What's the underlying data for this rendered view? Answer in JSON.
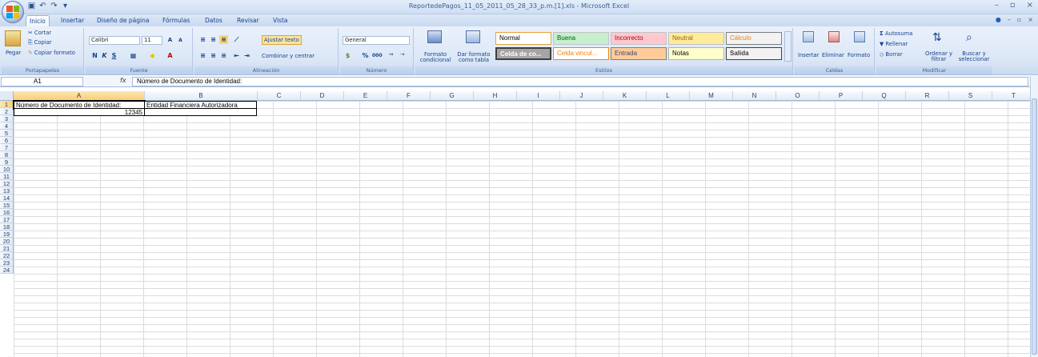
{
  "window": {
    "title": "ReportedePagos_11_05_2011_05_28_33_p.m.[1].xls - Microsoft Excel",
    "minimize": "–",
    "restore": "▫",
    "close": "×"
  },
  "tabs": [
    "Inicio",
    "Insertar",
    "Diseño de página",
    "Fórmulas",
    "Datos",
    "Revisar",
    "Vista"
  ],
  "ribbon": {
    "clipboard": {
      "label": "Portapapeles",
      "paste": "Pegar",
      "cut": "Cortar",
      "copy": "Copiar",
      "format_painter": "Copiar formato"
    },
    "font": {
      "label": "Fuente",
      "name": "Calibri",
      "size": "11",
      "bold": "N",
      "italic": "K",
      "underline": "S"
    },
    "alignment": {
      "label": "Alineación",
      "wrap": "Ajustar texto",
      "merge": "Combinar y centrar"
    },
    "number": {
      "label": "Número",
      "format": "General",
      "percent": "%",
      "thousands": "000"
    },
    "styles": {
      "label": "Estilos",
      "conditional": "Formato condicional",
      "as_table": "Dar formato como tabla",
      "cells": [
        {
          "name": "Normal",
          "bg": "#ffffff",
          "fg": "#000000"
        },
        {
          "name": "Buena",
          "bg": "#c6efce",
          "fg": "#006100"
        },
        {
          "name": "Incorrecto",
          "bg": "#ffc7ce",
          "fg": "#9c0006"
        },
        {
          "name": "Neutral",
          "bg": "#ffeb9c",
          "fg": "#9c6500"
        },
        {
          "name": "Cálculo",
          "bg": "#f2f2f2",
          "fg": "#fa7d00"
        },
        {
          "name": "Celda de co...",
          "bg": "#a5a5a5",
          "fg": "#ffffff"
        },
        {
          "name": "Celda vincul...",
          "bg": "#ffffff",
          "fg": "#fa7d00"
        },
        {
          "name": "Entrada",
          "bg": "#ffcc99",
          "fg": "#3f3f76"
        },
        {
          "name": "Notas",
          "bg": "#ffffcc",
          "fg": "#000000"
        },
        {
          "name": "Salida",
          "bg": "#f2f2f2",
          "fg": "#3f3f3f"
        }
      ]
    },
    "cells": {
      "label": "Celdas",
      "insert": "Insertar",
      "delete": "Eliminar",
      "format": "Formato"
    },
    "editing": {
      "label": "Modificar",
      "autosum": "Autosuma",
      "fill": "Rellenar",
      "clear": "Borrar",
      "sort": "Ordenar y filtrar",
      "find": "Buscar y seleccionar"
    }
  },
  "formula_bar": {
    "name_box": "A1",
    "fx": "fx",
    "value": "Número de Documento de Identidad:"
  },
  "sheet": {
    "columns": [
      "A",
      "B",
      "C",
      "D",
      "E",
      "F",
      "G",
      "H",
      "I",
      "J",
      "K",
      "L",
      "M",
      "N",
      "O",
      "P",
      "Q",
      "R",
      "S",
      "T"
    ],
    "rows": [
      "1",
      "2",
      "3",
      "4",
      "5",
      "6",
      "7",
      "8",
      "9",
      "10",
      "11",
      "12",
      "13",
      "14",
      "15",
      "16",
      "17",
      "18",
      "19",
      "20",
      "21",
      "22",
      "23",
      "24"
    ],
    "A1": "Número de Documento de Identidad:",
    "B1": "Entidad Financiera Autorizadora",
    "A2": "12345"
  }
}
